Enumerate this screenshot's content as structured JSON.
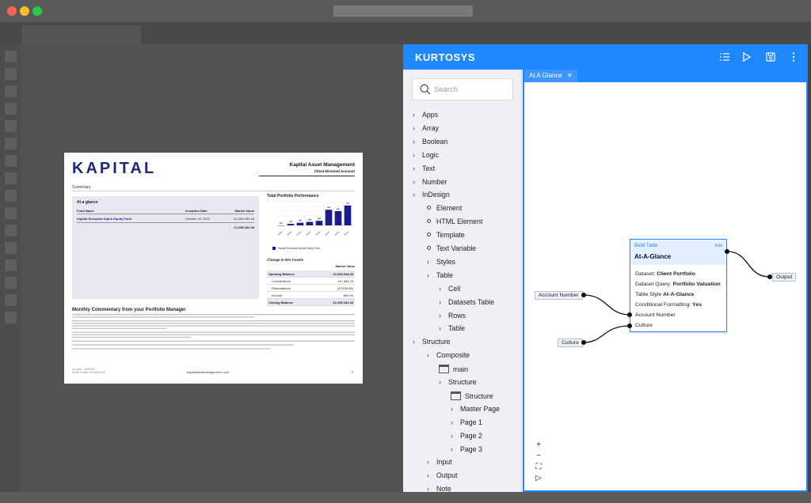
{
  "document": {
    "logo": "KAPITAL",
    "company": "Kapital Asset Management",
    "account_type": "Client-Directed Account",
    "section": "Summary",
    "at_a_glance": {
      "title": "At a glance",
      "headers": [
        "Fund Name",
        "Inception Date",
        "Market Value"
      ],
      "row": {
        "fund": "Kapital European Alpha Equity Fund",
        "date": "October 15, 2010",
        "value": "£2,495,182.48"
      },
      "total": "£2,495,182.48"
    },
    "performance_title": "Total Portfolio Performance",
    "legend": "Kapital European Alpha Equity Fund",
    "chart_data": {
      "type": "bar",
      "values": [
        0.0,
        3.2,
        5.6,
        7.5,
        9.6,
        33.0,
        30.0,
        42.0
      ],
      "ylim": [
        -10,
        50
      ]
    },
    "change_title": "Change in Net Assets",
    "change_header": "Market Value",
    "change_rows": [
      {
        "k": "Opening Balance",
        "v": "£2,349,048.39",
        "style": "bold"
      },
      {
        "k": "Contributions",
        "v": "147,481.23",
        "style": "indent"
      },
      {
        "k": "Redemptions",
        "v": "(47,839.83)",
        "style": "indent"
      },
      {
        "k": "Income",
        "v": "669.94",
        "style": "indent"
      },
      {
        "k": "Closing Balance",
        "v": "£2,495,182.48",
        "style": "bold"
      }
    ],
    "commentary_title": "Monthly Commentary from your Portfolio Manager",
    "footer_account": "Account – 8999347",
    "footer_date": "Month Ended: 30 April 2023",
    "footer_site": "kapitalassetmanagement.com",
    "footer_page": "2"
  },
  "app": {
    "brand": "KURTOSYS",
    "header_icons": [
      "list-icon",
      "play-icon",
      "save-icon",
      "more-icon"
    ],
    "search_placeholder": "Search",
    "tree": [
      {
        "label": "Apps",
        "kind": "chev",
        "level": 0
      },
      {
        "label": "Array",
        "kind": "chev",
        "level": 0
      },
      {
        "label": "Boolean",
        "kind": "chev",
        "level": 0
      },
      {
        "label": "Logic",
        "kind": "chev",
        "level": 0
      },
      {
        "label": "Text",
        "kind": "chev",
        "level": 0
      },
      {
        "label": "Number",
        "kind": "chev",
        "level": 0
      },
      {
        "label": "InDesign",
        "kind": "chev",
        "level": 0
      },
      {
        "label": "Element",
        "kind": "circle",
        "level": 1
      },
      {
        "label": "HTML Element",
        "kind": "circle",
        "level": 1
      },
      {
        "label": "Template",
        "kind": "circle",
        "level": 1
      },
      {
        "label": "Text Variable",
        "kind": "circle",
        "level": 1
      },
      {
        "label": "Styles",
        "kind": "chev",
        "level": 1
      },
      {
        "label": "Table",
        "kind": "chev",
        "level": 1
      },
      {
        "label": "Cell",
        "kind": "chev",
        "level": 2
      },
      {
        "label": "Datasets Table",
        "kind": "chev",
        "level": 2
      },
      {
        "label": "Rows",
        "kind": "chev",
        "level": 2
      },
      {
        "label": "Table",
        "kind": "chev",
        "level": 2
      },
      {
        "label": "Structure",
        "kind": "chev",
        "level": 0
      },
      {
        "label": "Composite",
        "kind": "chev",
        "level": 1
      },
      {
        "label": "main",
        "kind": "window",
        "level": 2
      },
      {
        "label": "Structure",
        "kind": "chev",
        "level": 2
      },
      {
        "label": "Structure",
        "kind": "window",
        "level": 3
      },
      {
        "label": "Master Page",
        "kind": "chev",
        "level": 3
      },
      {
        "label": "Page 1",
        "kind": "chev",
        "level": 3
      },
      {
        "label": "Page 2",
        "kind": "chev",
        "level": 3
      },
      {
        "label": "Page 3",
        "kind": "chev",
        "level": 3
      },
      {
        "label": "Input",
        "kind": "chev",
        "level": 1
      },
      {
        "label": "Output",
        "kind": "chev",
        "level": 1
      },
      {
        "label": "Note",
        "kind": "chev",
        "level": 1
      }
    ],
    "editor_tab": "At A Glance",
    "node": {
      "kicker": "Build Table",
      "badge": "Edit",
      "title": "At-A-Glance",
      "dataset_label": "Dataset:",
      "dataset_value": "Client Portfolio",
      "query_label": "Dataset Query:",
      "query_value": "Portfolio Valuation",
      "style_label": "Table Style",
      "style_value": "At-A-Glance",
      "cf_label": "Conditional Formatting:",
      "cf_value": "Yes",
      "in_account": "Account Number",
      "in_culture": "Culture"
    },
    "pills": {
      "account": "Account Number",
      "culture": "Culture",
      "output": "Output"
    },
    "zoom_controls": [
      "+",
      "−",
      "⛶",
      "▷"
    ]
  }
}
